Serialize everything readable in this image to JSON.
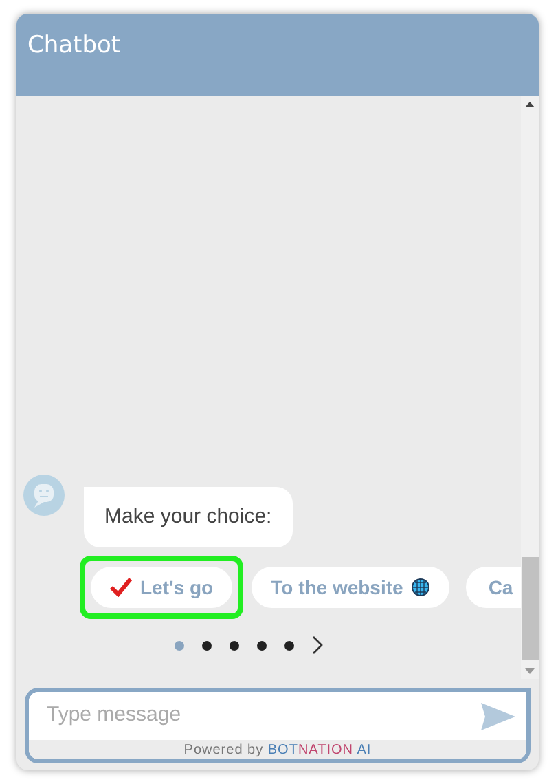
{
  "header": {
    "title": "Chatbot"
  },
  "message": {
    "text": "Make your choice:"
  },
  "choices": [
    {
      "label": "Let's go",
      "kind": "check",
      "highlighted": true
    },
    {
      "label": "To the website",
      "kind": "globe",
      "highlighted": false
    },
    {
      "label": "Ca",
      "kind": "plain",
      "highlighted": false
    }
  ],
  "carousel_dots": [
    {
      "selected": true
    },
    {
      "selected": false
    },
    {
      "selected": false
    },
    {
      "selected": false
    },
    {
      "selected": false
    }
  ],
  "input": {
    "placeholder": "Type message"
  },
  "footer": {
    "prefix": "Powered by ",
    "brand": [
      {
        "text": "BOT",
        "color": "#4a7fb5"
      },
      {
        "text": "NATION",
        "color": "#c0456e"
      },
      {
        "text": " AI",
        "color": "#4a7fb5"
      }
    ]
  }
}
